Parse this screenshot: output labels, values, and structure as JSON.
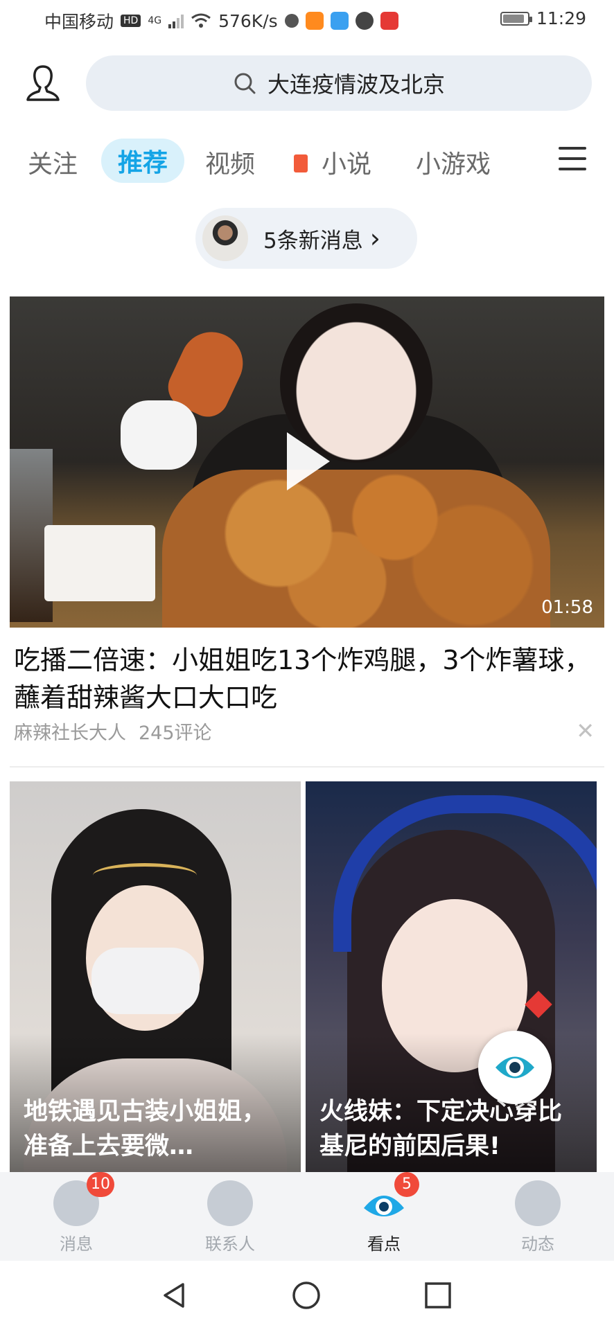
{
  "status_bar": {
    "carrier": "中国移动",
    "hd_badge": "HD",
    "network": "4G",
    "speed": "576K/s",
    "time": "11:29"
  },
  "search": {
    "query": "大连疫情波及北京"
  },
  "tabs": [
    {
      "label": "关注"
    },
    {
      "label": "推荐",
      "active": true
    },
    {
      "label": "视频"
    },
    {
      "label": "小说"
    },
    {
      "label": "小游戏"
    }
  ],
  "new_messages": {
    "label": "5条新消息",
    "arrow": "›"
  },
  "feed": {
    "video1": {
      "duration": "01:58",
      "title": "吃播二倍速：小姐姐吃13个炸鸡腿，3个炸薯球，蘸着甜辣酱大口大口吃",
      "author": "麻辣社长大人",
      "comments": "245评论",
      "dismiss": "✕"
    },
    "cards": [
      {
        "title": "地铁遇见古装小姐姐，准备上去要微…"
      },
      {
        "title": "火线妹：下定决心穿比基尼的前因后果!"
      }
    ]
  },
  "bottom_nav": [
    {
      "label": "消息",
      "badge": "10",
      "icon": "chat-face-icon"
    },
    {
      "label": "联系人",
      "badge": "",
      "icon": "contacts-icon"
    },
    {
      "label": "看点",
      "badge": "5",
      "icon": "eye-icon",
      "active": true
    },
    {
      "label": "动态",
      "badge": "",
      "icon": "planet-star-icon"
    }
  ],
  "colors": {
    "accent": "#14a4e6",
    "badge": "#f04a3a",
    "tab_active_bg": "#d9f1fb"
  }
}
